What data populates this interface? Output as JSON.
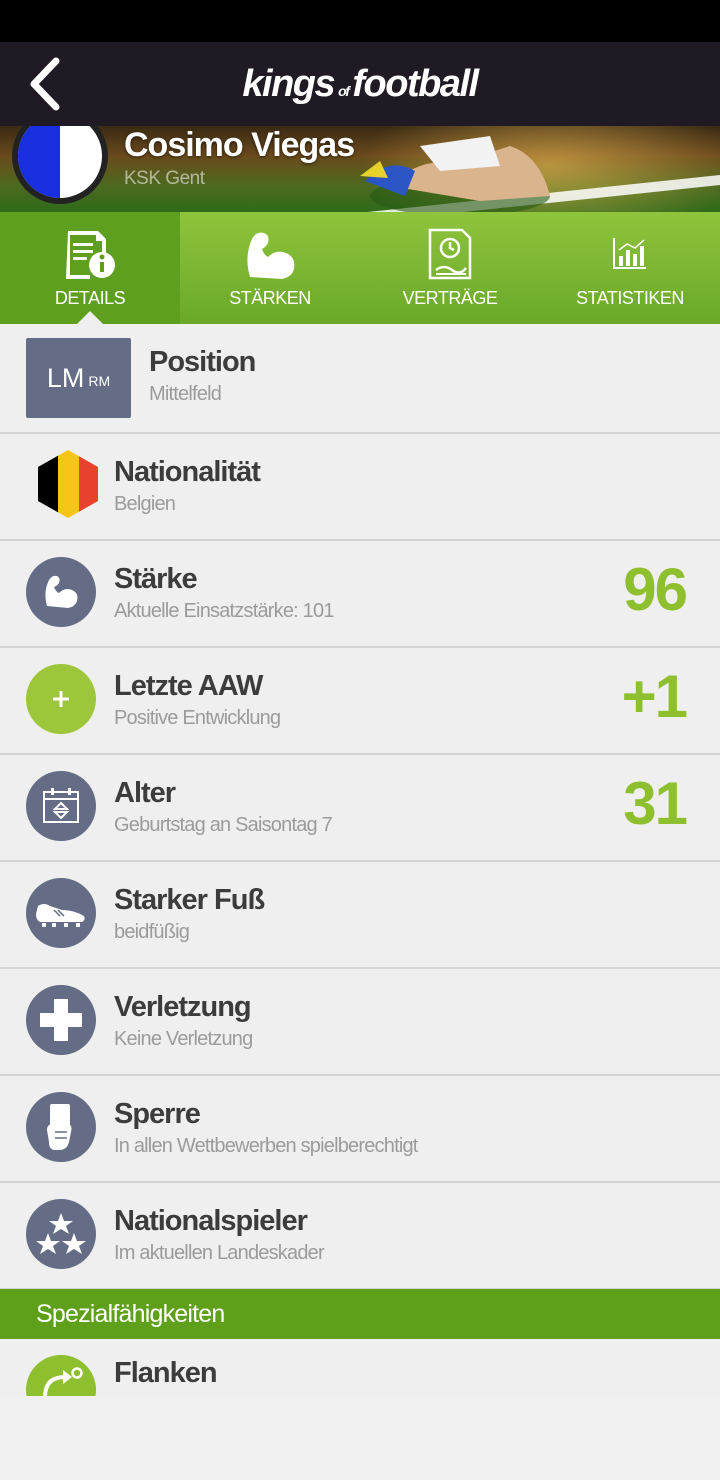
{
  "app": {
    "logo_left": "kings",
    "logo_of": "of",
    "logo_right": "football"
  },
  "player": {
    "name": "Cosimo Viegas",
    "club": "KSK Gent"
  },
  "tabs": [
    {
      "label": "DETAILS",
      "icon": "document-info-icon",
      "active": true
    },
    {
      "label": "STÄRKEN",
      "icon": "bicep-icon",
      "active": false
    },
    {
      "label": "VERTRÄGE",
      "icon": "contract-clock-icon",
      "active": false
    },
    {
      "label": "STATISTIKEN",
      "icon": "bar-chart-icon",
      "active": false
    }
  ],
  "details": {
    "position": {
      "box_main": "LM",
      "box_sub": "RM",
      "title": "Position",
      "subtitle": "Mittelfeld"
    },
    "nationality": {
      "title": "Nationalität",
      "subtitle": "Belgien",
      "flag_colors": [
        "#000000",
        "#f5c518",
        "#e8412c"
      ]
    },
    "strength": {
      "title": "Stärke",
      "subtitle": "Aktuelle Einsatzstärke: 101",
      "value": "96"
    },
    "last_aaw": {
      "title": "Letzte AAW",
      "subtitle": "Positive Entwicklung",
      "value": "+1"
    },
    "age": {
      "title": "Alter",
      "subtitle": "Geburtstag an Saisontag 7",
      "value": "31"
    },
    "foot": {
      "title": "Starker Fuß",
      "subtitle": "beidfüßig"
    },
    "injury": {
      "title": "Verletzung",
      "subtitle": "Keine Verletzung"
    },
    "suspension": {
      "title": "Sperre",
      "subtitle": "In allen Wettbewerben spielberechtigt"
    },
    "national": {
      "title": "Nationalspieler",
      "subtitle": "Im aktuellen Landeskader"
    }
  },
  "special": {
    "header": "Spezialfähigkeiten",
    "first_item": "Flanken"
  },
  "colors": {
    "accent_green": "#8dbf2e",
    "tab_green": "#6aa829",
    "icon_slate": "#646d85",
    "appbar": "#1f1a24"
  }
}
